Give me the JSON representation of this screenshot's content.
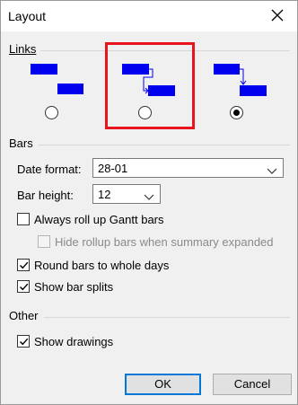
{
  "window": {
    "title": "Layout"
  },
  "links": {
    "label": "Links",
    "accent": "L",
    "options": [
      {
        "name": "no-link-lines",
        "selected": false
      },
      {
        "name": "s-shaped-link-lines",
        "selected": false
      },
      {
        "name": "l-shaped-link-lines",
        "selected": true
      }
    ],
    "bar_color": "#0000ee",
    "highlight_color": "#e8141e"
  },
  "bars": {
    "label": "Bars",
    "date_format": {
      "label": "Date format:",
      "value": "28-01"
    },
    "bar_height": {
      "label": "Bar height:",
      "value": "12"
    },
    "checkboxes": [
      {
        "label": "Always roll up Gantt bars",
        "checked": false,
        "enabled": true
      },
      {
        "label": "Hide rollup bars when summary expanded",
        "checked": false,
        "enabled": false
      },
      {
        "label": "Round bars to whole days",
        "checked": true,
        "enabled": true
      },
      {
        "label": "Show bar splits",
        "checked": true,
        "enabled": true
      }
    ]
  },
  "other": {
    "label": "Other",
    "checkboxes": [
      {
        "label": "Show drawings",
        "checked": true,
        "enabled": true
      }
    ]
  },
  "buttons": {
    "ok": "OK",
    "cancel": "Cancel"
  },
  "accent_color": "#0078d7"
}
